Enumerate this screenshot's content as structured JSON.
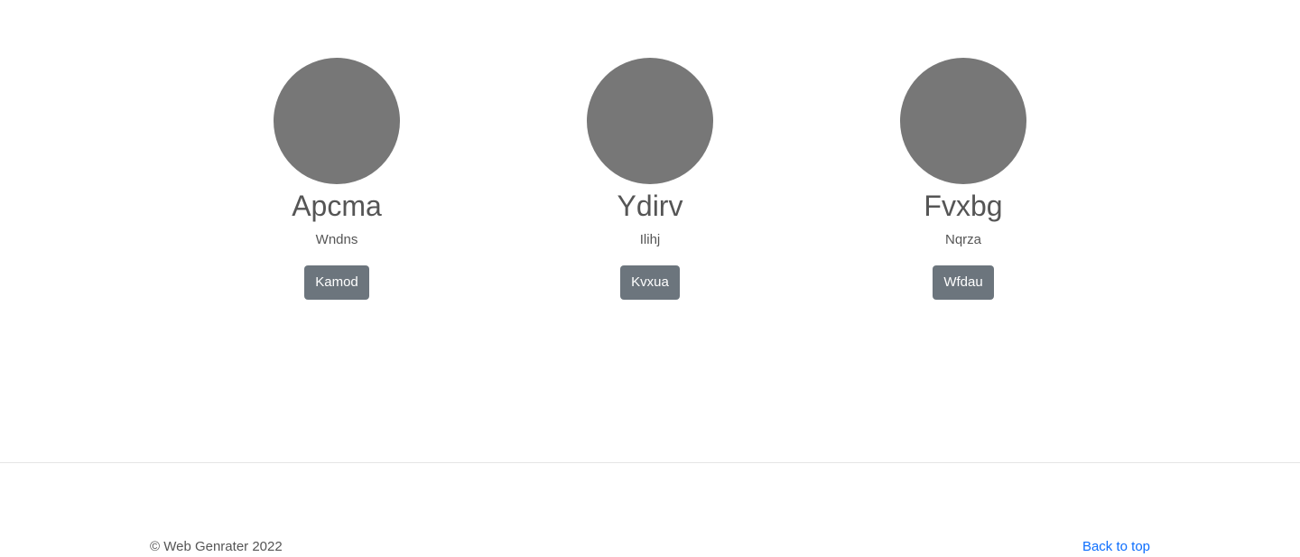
{
  "profiles": [
    {
      "name": "Apcma",
      "subtitle": "Wndns",
      "button": "Kamod"
    },
    {
      "name": "Ydirv",
      "subtitle": "Ilihj",
      "button": "Kvxua"
    },
    {
      "name": "Fvxbg",
      "subtitle": "Nqrza",
      "button": "Wfdau"
    }
  ],
  "footer": {
    "copyright": "© Web Genrater 2022",
    "back_to_top": "Back to top"
  },
  "colors": {
    "avatar": "#777777",
    "button": "#6c757d",
    "link": "#0d6efd",
    "text": "#555555"
  }
}
